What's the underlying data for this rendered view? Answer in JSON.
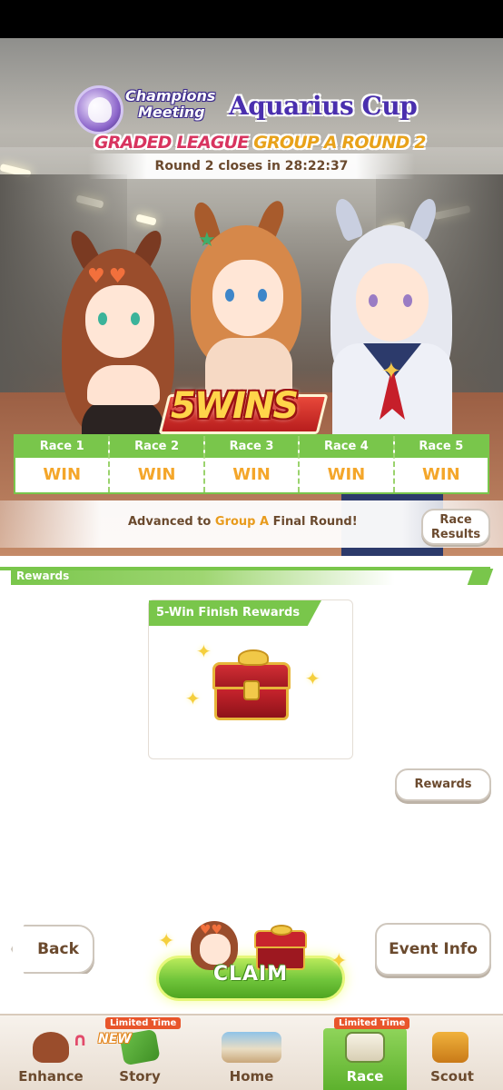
{
  "event": {
    "title_line1": "Champions",
    "title_line2": "Meeting",
    "cup_name": "Aquarius Cup",
    "league_part1": "GRADED LEAGUE",
    "league_part2": "GROUP A ROUND 2",
    "countdown": "Round 2 closes in 28:22:37",
    "wins_banner": "5WINS"
  },
  "races": [
    {
      "label": "Race 1",
      "result": "WIN"
    },
    {
      "label": "Race 2",
      "result": "WIN"
    },
    {
      "label": "Race 3",
      "result": "WIN"
    },
    {
      "label": "Race 4",
      "result": "WIN"
    },
    {
      "label": "Race 5",
      "result": "WIN"
    }
  ],
  "advance": {
    "prefix": "Advanced to ",
    "highlight": "Group A",
    "suffix": " Final Round!",
    "results_button_line1": "Race",
    "results_button_line2": "Results"
  },
  "rewards": {
    "section_title": "Rewards",
    "card_title": "5-Win Finish Rewards",
    "button_label": "Rewards"
  },
  "actions": {
    "back": "Back",
    "claim": "CLAIM",
    "event_info": "Event Info"
  },
  "tabs": [
    {
      "label": "Enhance",
      "badge": ""
    },
    {
      "label": "Story",
      "badge": "Limited Time",
      "new": "NEW"
    },
    {
      "label": "Home",
      "badge": ""
    },
    {
      "label": "Race",
      "badge": "Limited Time"
    },
    {
      "label": "Scout",
      "badge": ""
    }
  ],
  "colors": {
    "accent_green": "#79c64b",
    "win_orange": "#f4a62a",
    "text_brown": "#6b4a2e",
    "cup_purple": "#4a2fae"
  }
}
